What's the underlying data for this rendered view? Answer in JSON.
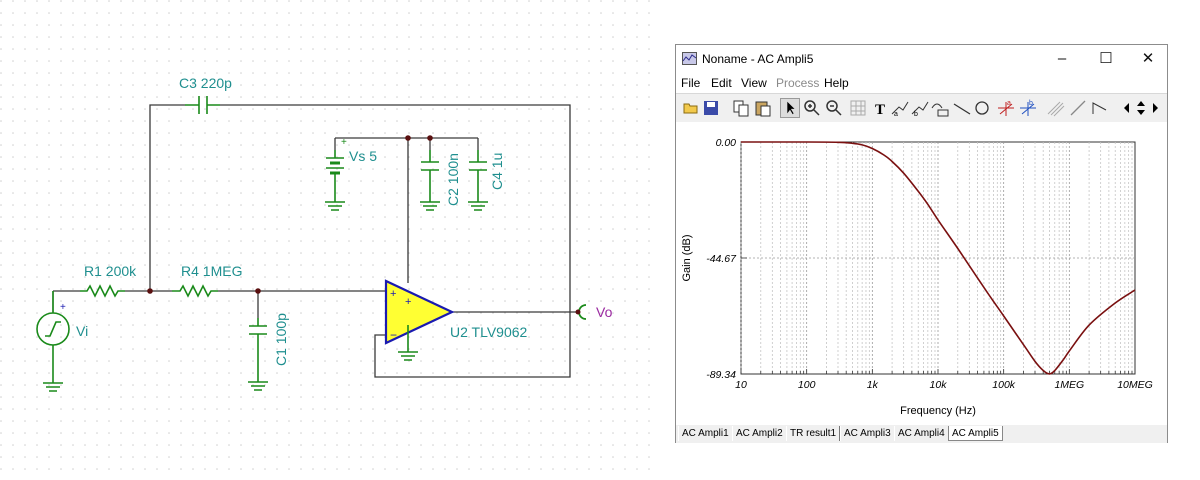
{
  "schematic": {
    "components": {
      "c3": "C3 220p",
      "vs": "Vs 5",
      "c2": "C2 100n",
      "c4": "C4 1u",
      "r1": "R1 200k",
      "r4": "R4 1MEG",
      "vi": "Vi",
      "c1": "C1 100p",
      "u2": "U2 TLV9062",
      "vo": "Vo"
    },
    "colors": {
      "component": "#1a8a1a",
      "label": "#1f8f8f",
      "opamp_fill": "#ffff33",
      "opamp_stroke": "#1a1ab0",
      "output_label": "#9a2aa0"
    }
  },
  "window": {
    "title": "Noname - AC Ampli5",
    "menu": [
      {
        "label": "File",
        "enabled": true
      },
      {
        "label": "Edit",
        "enabled": true
      },
      {
        "label": "View",
        "enabled": true
      },
      {
        "label": "Process",
        "enabled": false
      },
      {
        "label": "Help",
        "enabled": true
      }
    ],
    "toolbar": [
      "open-icon",
      "save-icon",
      "copy-icon",
      "paste-icon",
      "pointer-icon",
      "zoom-in-icon",
      "zoom-out-icon",
      "grid-icon",
      "text-icon",
      "cursor-a-icon",
      "cursor-b-icon",
      "cursor-z-icon",
      "line-icon",
      "circle-icon",
      "marker-a-icon",
      "marker-b-icon",
      "hatch-icon",
      "arrow-icon",
      "step-icon",
      "prev-icon",
      "next-icon"
    ],
    "tabs": [
      {
        "label": "AC Ampli1",
        "active": false
      },
      {
        "label": "AC Ampli2",
        "active": false
      },
      {
        "label": "TR result1",
        "active": false
      },
      {
        "label": "AC Ampli3",
        "active": false
      },
      {
        "label": "AC Ampli4",
        "active": false
      },
      {
        "label": "AC Ampli5",
        "active": true
      }
    ]
  },
  "chart_data": {
    "type": "line",
    "xlabel": "Frequency (Hz)",
    "ylabel": "Gain (dB)",
    "x_scale": "log",
    "xlim": [
      10,
      10000000
    ],
    "ylim": [
      -89.34,
      0
    ],
    "x_ticks": [
      "10",
      "100",
      "1k",
      "10k",
      "100k",
      "1MEG",
      "10MEG"
    ],
    "y_ticks": [
      "0.00",
      "-44.67",
      "-89.34"
    ],
    "line_color": "#7a1010",
    "grid": true,
    "series": [
      {
        "x": [
          10,
          100,
          300,
          500,
          700,
          1000,
          1500,
          2000,
          3000,
          5000,
          7000,
          10000,
          20000,
          50000,
          100000,
          200000,
          300000,
          400000,
          500000,
          600000,
          800000,
          1000000,
          2000000,
          5000000,
          10000000
        ],
        "y": [
          0,
          0,
          -0.1,
          -0.5,
          -1.1,
          -2.5,
          -5.0,
          -7.5,
          -12.0,
          -19.0,
          -24.0,
          -30.0,
          -41.0,
          -56.0,
          -67.0,
          -78.0,
          -84.5,
          -88.0,
          -89.3,
          -88.0,
          -84.0,
          -80.5,
          -70.5,
          -62.0,
          -57.0
        ]
      }
    ]
  }
}
